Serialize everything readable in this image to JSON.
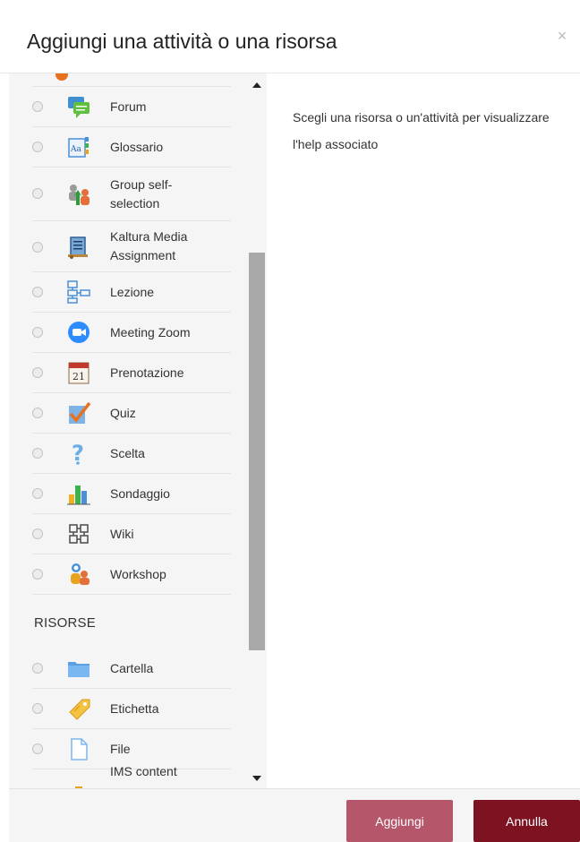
{
  "dialog": {
    "title": "Aggiungi una attività o una risorsa",
    "close_label": "×"
  },
  "activities": [
    {
      "label": "Forum",
      "icon": "forum-icon"
    },
    {
      "label": "Glossario",
      "icon": "glossary-icon"
    },
    {
      "label": "Group self-\nselection",
      "icon": "group-self-selection-icon"
    },
    {
      "label": "Kaltura Media\nAssignment",
      "icon": "kaltura-media-icon"
    },
    {
      "label": "Lezione",
      "icon": "lesson-icon"
    },
    {
      "label": "Meeting Zoom",
      "icon": "zoom-meeting-icon"
    },
    {
      "label": "Prenotazione",
      "icon": "calendar-icon"
    },
    {
      "label": "Quiz",
      "icon": "quiz-icon"
    },
    {
      "label": "Scelta",
      "icon": "choice-question-icon"
    },
    {
      "label": "Sondaggio",
      "icon": "survey-chart-icon"
    },
    {
      "label": "Wiki",
      "icon": "wiki-icon"
    },
    {
      "label": "Workshop",
      "icon": "workshop-icon"
    }
  ],
  "resources_heading": "RISORSE",
  "resources": [
    {
      "label": "Cartella",
      "icon": "folder-icon"
    },
    {
      "label": "Etichetta",
      "icon": "label-tag-icon"
    },
    {
      "label": "File",
      "icon": "file-icon"
    },
    {
      "label": "IMS content",
      "icon": "ims-content-icon"
    }
  ],
  "help": {
    "text": "Scegli una risorsa o un'attività per visualizzare l'help associato"
  },
  "footer": {
    "add_label": "Aggiungi",
    "cancel_label": "Annulla"
  },
  "colors": {
    "add_button": "#b5566a",
    "cancel_button": "#7d1220",
    "pane_background": "#f5f5f5"
  }
}
